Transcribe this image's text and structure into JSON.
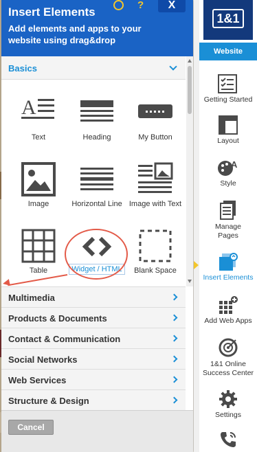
{
  "panel": {
    "title": "Insert Elements",
    "subtitle": "Add elements and apps to your website using drag&drop",
    "close_label": "X",
    "help_label": "?",
    "compass_label": "⊘"
  },
  "basics": {
    "label": "Basics",
    "elements": [
      {
        "label": "Text",
        "icon": "text-icon"
      },
      {
        "label": "Heading",
        "icon": "heading-icon"
      },
      {
        "label": "My Button",
        "icon": "button-icon"
      },
      {
        "label": "Image",
        "icon": "image-icon"
      },
      {
        "label": "Horizontal Line",
        "icon": "horizontal-line-icon"
      },
      {
        "label": "Image with Text",
        "icon": "image-with-text-icon"
      },
      {
        "label": "Table",
        "icon": "table-icon"
      },
      {
        "label": "Widget / HTML",
        "icon": "code-icon"
      },
      {
        "label": "Blank Space",
        "icon": "blank-space-icon"
      }
    ]
  },
  "categories": [
    "Multimedia",
    "Products & Documents",
    "Contact & Communication",
    "Social Networks",
    "Web Services",
    "Structure & Design"
  ],
  "footer": {
    "cancel_label": "Cancel"
  },
  "sidebar": {
    "logo_text": "1&1",
    "website_label": "Website",
    "items": [
      {
        "label": "Getting Started",
        "icon": "checklist-icon"
      },
      {
        "label": "Layout",
        "icon": "layout-icon"
      },
      {
        "label": "Style",
        "icon": "style-icon"
      },
      {
        "label": "Manage Pages",
        "icon": "pages-icon"
      },
      {
        "label": "Insert Elements",
        "icon": "insert-elements-icon"
      },
      {
        "label": "Add Web Apps",
        "icon": "web-apps-icon"
      },
      {
        "label": "1&1 Online Success Center",
        "icon": "success-center-icon"
      },
      {
        "label": "Settings",
        "icon": "gear-icon"
      },
      {
        "label": "",
        "icon": "phone-icon"
      }
    ]
  },
  "colors": {
    "brand_blue": "#1a63c5",
    "accent": "#1a8fd6",
    "highlight": "#e35a48",
    "logo_navy": "#13397c"
  }
}
